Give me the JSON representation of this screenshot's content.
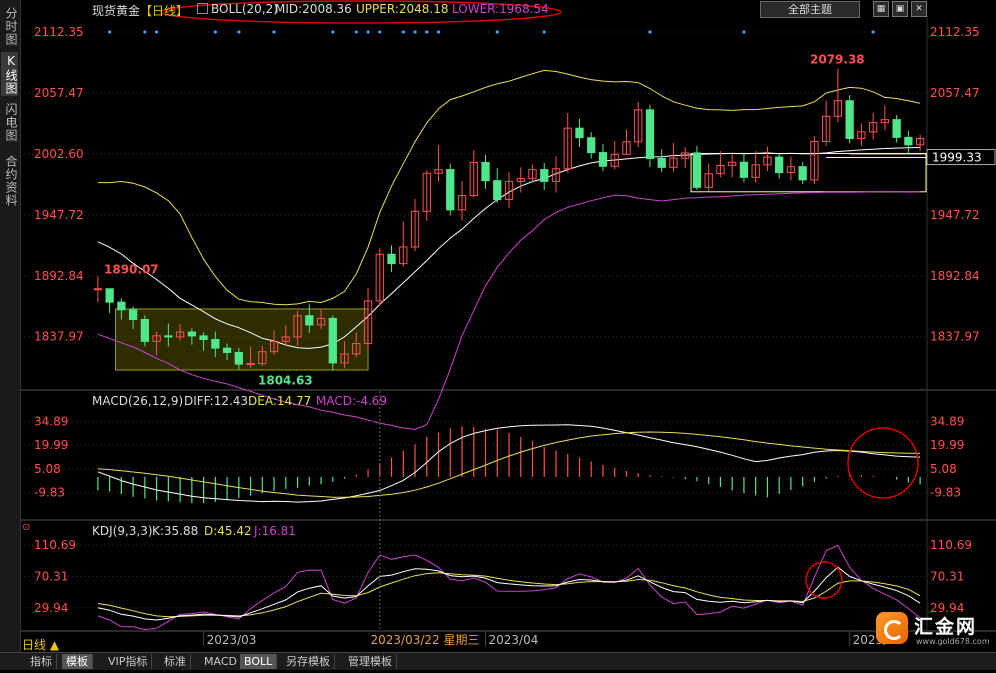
{
  "sidebar": {
    "tabs": [
      {
        "label": "分时图",
        "active": false
      },
      {
        "label": "K线图",
        "active": true
      },
      {
        "label": "闪电图",
        "active": false
      },
      {
        "label": "合约资料",
        "active": false
      }
    ]
  },
  "header": {
    "symbol": "现货黄金",
    "period_tag": "【日线】",
    "indicator": "BOLL(20,2)",
    "mid_label": "MID:2008.36",
    "upper_label": "UPPER:2048.18",
    "lower_label": "LOWER:1968.54",
    "theme_button": "全部主题",
    "window_buttons": [
      "▦",
      "▣",
      "✕"
    ]
  },
  "macd_header": {
    "title": "MACD(26,12,9)",
    "diff": "DIFF:12.43",
    "dea": "DEA:14.77",
    "macd": "MACD:-4.69"
  },
  "kdj_header": {
    "title": "KDJ(9,3,3)",
    "k": "K:35.88",
    "d": "D:45.42",
    "j": "J:16.81"
  },
  "crosshair_date": "2023/03/22 星期三",
  "period_selector": "日线 ▲",
  "bottom_tabs": [
    {
      "label": "指标",
      "active": false
    },
    {
      "label": "模板",
      "active": true
    },
    {
      "label": "VIP指标",
      "active": false
    },
    {
      "label": "标准",
      "active": false
    },
    {
      "label": "MACD",
      "active": false
    },
    {
      "label": "BOLL",
      "active": true
    },
    {
      "label": "另存模板",
      "active": false
    },
    {
      "label": "管理模板",
      "active": false
    }
  ],
  "logo": {
    "name": "汇金网",
    "url": "www.gold678.com"
  },
  "colors": {
    "up": "#ff5050",
    "down": "#50e68c",
    "mid": "#ffffa0",
    "boll": "#e8e050",
    "lower": "#d040d0",
    "axis_text": "#ff5050",
    "grid": "#2a2a2a",
    "annotation": "#e00000"
  },
  "chart_data": [
    {
      "type": "candlestick",
      "title": "现货黄金 日线 BOLL(20,2)",
      "y_ticks": [
        "2112.35",
        "2057.47",
        "2002.60",
        "1947.72",
        "1892.84",
        "1837.97"
      ],
      "ylim": [
        1790,
        2125
      ],
      "x_ticks": [
        "2023/03",
        "2023/04",
        "2023/05"
      ],
      "labels": {
        "high": "2079.38",
        "low": "1804.63",
        "start_high": "1890.07",
        "current": "1999.33"
      },
      "candles": [
        [
          1881.2,
          1881.2,
          1892.5,
          1869.1
        ],
        [
          1881.2,
          1869.1,
          1874.1,
          1859.1
        ],
        [
          1869.1,
          1862.2,
          1872.5,
          1853.5
        ],
        [
          1862.2,
          1853.5,
          1865.2,
          1845.1
        ],
        [
          1853.5,
          1833.8,
          1857.2,
          1829.4
        ],
        [
          1833.8,
          1838.8,
          1842.5,
          1821.4
        ],
        [
          1838.8,
          1837.8,
          1849.8,
          1829.1
        ],
        [
          1837.8,
          1842.2,
          1849.2,
          1834.4
        ],
        [
          1842.2,
          1838.7,
          1845.5,
          1830.8
        ],
        [
          1838.7,
          1835.5,
          1841.9,
          1825.4
        ],
        [
          1835.5,
          1827.7,
          1842.5,
          1819.6
        ],
        [
          1827.7,
          1823.8,
          1831.8,
          1816.9
        ],
        [
          1823.8,
          1813.3,
          1827.8,
          1808.5
        ],
        [
          1813.3,
          1813.8,
          1829.1,
          1809.5
        ],
        [
          1813.8,
          1824.5,
          1829.8,
          1811.6
        ],
        [
          1824.5,
          1833.8,
          1843.5,
          1821.6
        ],
        [
          1833.8,
          1837.8,
          1848.3,
          1829.8
        ],
        [
          1837.8,
          1856.9,
          1861.5,
          1829.8
        ],
        [
          1856.9,
          1848.6,
          1867.8,
          1841.5
        ],
        [
          1848.6,
          1854.5,
          1862.5,
          1845.1
        ],
        [
          1854.5,
          1814.4,
          1857.1,
          1807.5
        ],
        [
          1814.4,
          1822.4,
          1833.9,
          1809.5
        ],
        [
          1822.4,
          1831.8,
          1841.9,
          1819.5
        ],
        [
          1831.8,
          1870.2,
          1881.8,
          1825.4
        ],
        [
          1870.2,
          1912.2,
          1917.8,
          1866.2
        ],
        [
          1912.2,
          1903.8,
          1920.3,
          1896.2
        ],
        [
          1903.8,
          1918.8,
          1941.6,
          1901.2
        ],
        [
          1918.8,
          1950.9,
          1962.1,
          1915.1
        ],
        [
          1950.9,
          1985.2,
          1987.8,
          1942.5
        ],
        [
          1985.2,
          1988.5,
          2010.5,
          1977.8
        ],
        [
          1988.5,
          1952.2,
          1993.9,
          1947.1
        ],
        [
          1952.2,
          1965.1,
          1978.1,
          1942.5
        ],
        [
          1965.1,
          1994.9,
          2005.8,
          1963.5
        ],
        [
          1994.9,
          1978.5,
          2001.8,
          1971.2
        ],
        [
          1978.5,
          1961.5,
          1989.8,
          1958.5
        ],
        [
          1961.5,
          1977.8,
          1986.1,
          1953.8
        ],
        [
          1977.8,
          1980.3,
          1990.5,
          1967.8
        ],
        [
          1980.3,
          1988.5,
          1992.9,
          1977.1
        ],
        [
          1988.5,
          1977.8,
          1994.5,
          1970.2
        ],
        [
          1977.8,
          1989.2,
          2000.5,
          1967.8
        ],
        [
          1989.2,
          2025.8,
          2039.5,
          1985.8
        ],
        [
          2025.8,
          2017.2,
          2034.2,
          2008.8
        ],
        [
          2017.2,
          2003.8,
          2022.2,
          1998.5
        ],
        [
          2003.8,
          1991.5,
          2011.8,
          1987.1
        ],
        [
          1991.5,
          2002.2,
          2014.1,
          1988.5
        ],
        [
          2002.2,
          2013.5,
          2024.5,
          2001.8
        ],
        [
          2013.5,
          2042.3,
          2049.5,
          2008.8
        ],
        [
          2042.3,
          1998.5,
          2046.8,
          1990.8
        ],
        [
          1998.5,
          1990.5,
          2006.8,
          1986.1
        ],
        [
          1990.5,
          1998.8,
          2012.5,
          1986.8
        ],
        [
          1998.8,
          2003.5,
          2008.8,
          1989.8
        ],
        [
          2003.5,
          1972.5,
          2009.8,
          1970.2
        ],
        [
          1972.5,
          1984.8,
          1993.9,
          1969.1
        ],
        [
          1984.8,
          1992.2,
          2005.1,
          1981.5
        ],
        [
          1992.2,
          1995.1,
          2002.2,
          1981.5
        ],
        [
          1995.1,
          1981.5,
          2002.8,
          1977.1
        ],
        [
          1981.5,
          1992.8,
          2005.1,
          1976.8
        ],
        [
          1992.8,
          1999.8,
          2009.2,
          1987.1
        ],
        [
          1999.8,
          1985.8,
          2002.8,
          1980.5
        ],
        [
          1985.8,
          1991.1,
          2000.1,
          1978.8
        ],
        [
          1991.1,
          1979.2,
          1995.5,
          1975.5
        ],
        [
          1979.2,
          2013.8,
          2018.5,
          1975.5
        ],
        [
          2013.8,
          2036.5,
          2050.8,
          2009.8
        ],
        [
          2036.5,
          2050.5,
          2079.4,
          2030.8
        ],
        [
          2050.5,
          2016.5,
          2055.5,
          2012.2
        ],
        [
          2016.5,
          2022.5,
          2030.1,
          2009.8
        ],
        [
          2022.5,
          2030.8,
          2039.8,
          2015.5
        ],
        [
          2030.8,
          2033.5,
          2046.2,
          2023.8
        ],
        [
          2033.5,
          2017.5,
          2037.5,
          2012.8
        ],
        [
          2017.5,
          2010.8,
          2023.5,
          2002.8
        ],
        [
          2010.8,
          2016.5,
          2019.8,
          2005.5
        ]
      ],
      "boll_mid": [
        1923.5,
        1918.5,
        1912.5,
        1904.1,
        1896.8,
        1889.5,
        1881.5,
        1872.5,
        1866.6,
        1860.5,
        1854.1,
        1849.5,
        1846.1,
        1841.6,
        1836.6,
        1834.1,
        1830.5,
        1828.1,
        1827.5,
        1828.6,
        1831.6,
        1837.8,
        1846.9,
        1856.2,
        1867.1,
        1876.8,
        1886.5,
        1896.5,
        1906.5,
        1917.2,
        1926.8,
        1934.8,
        1944.5,
        1953.5,
        1961.5,
        1968.2,
        1973.5,
        1977.8,
        1980.5,
        1984.8,
        1988.5,
        1991.8,
        1994.5,
        1996.2,
        1997.1,
        1998.1,
        1999.1,
        1999.8,
        2000.1,
        2001.1,
        2001.5,
        2002.1,
        2002.5,
        2002.8,
        2003.1,
        2002.8,
        2003.1,
        2003.5,
        2002.8,
        2003.1,
        2002.8,
        2002.8,
        2003.5,
        2004.8,
        2005.5,
        2006.2,
        2006.8,
        2007.5,
        2007.8,
        2008.1,
        2008.36
      ],
      "boll_upper": [
        1976.8,
        1976.8,
        1977.8,
        1976.2,
        1972.8,
        1967.5,
        1960.5,
        1948.5,
        1927.5,
        1907.8,
        1892.2,
        1879.8,
        1871.8,
        1869.5,
        1868.8,
        1867.2,
        1866.8,
        1867.5,
        1869.8,
        1868.8,
        1872.5,
        1878.8,
        1894.5,
        1918.5,
        1949.8,
        1973.5,
        1993.8,
        2013.5,
        2030.5,
        2043.2,
        2051.5,
        2054.8,
        2058.5,
        2062.5,
        2065.8,
        2068.1,
        2071.5,
        2074.8,
        2077.8,
        2076.8,
        2074.5,
        2071.8,
        2069.5,
        2068.2,
        2067.5,
        2067.8,
        2066.8,
        2061.5,
        2054.8,
        2049.5,
        2046.5,
        2043.8,
        2042.5,
        2042.2,
        2041.8,
        2042.5,
        2042.5,
        2043.5,
        2044.5,
        2045.2,
        2045.8,
        2049.5,
        2057.5,
        2060.2,
        2062.5,
        2061.8,
        2058.5,
        2053.5,
        2052.5,
        2050.5,
        2048.18
      ],
      "boll_lower": [
        1840.2,
        1836.5,
        1832.5,
        1828.8,
        1823.8,
        1818.5,
        1813.8,
        1808.1,
        1803.8,
        1800.5,
        1797.8,
        1795.5,
        1792.2,
        1788.8,
        1785.1,
        1782.1,
        1778.8,
        1776.8,
        1774.8,
        1771.8,
        1769.8,
        1767.5,
        1765.8,
        1762.8,
        1760.2,
        1758.1,
        1755.8,
        1754.5,
        1758.8,
        1781.5,
        1808.8,
        1838.8,
        1861.5,
        1883.8,
        1900.5,
        1913.5,
        1924.8,
        1933.5,
        1943.5,
        1949.8,
        1954.5,
        1957.5,
        1960.5,
        1963.1,
        1965.5,
        1964.8,
        1962.8,
        1961.5,
        1960.2,
        1961.5,
        1962.8,
        1963.1,
        1963.8,
        1964.1,
        1964.8,
        1965.5,
        1965.8,
        1966.2,
        1966.8,
        1967.2,
        1967.5,
        1967.8,
        1968.1,
        1968.1,
        1968.1,
        1968.2,
        1968.5,
        1968.8,
        1968.5,
        1968.2,
        1968.54
      ],
      "level_lines": [
        1999.33,
        2002.6
      ]
    },
    {
      "type": "macd",
      "title": "MACD(26,12,9)",
      "y_ticks": [
        "34.89",
        "19.99",
        "5.08",
        "-9.83"
      ],
      "ylim": [
        -22,
        42
      ],
      "diff": [
        3.2,
        0.5,
        -2.3,
        -4.5,
        -6.3,
        -8.2,
        -9.5,
        -10.8,
        -12.1,
        -13.0,
        -13.6,
        -14.2,
        -14.8,
        -15.1,
        -15.5,
        -15.2,
        -15.4,
        -15.8,
        -15.5,
        -15.1,
        -14.1,
        -13.2,
        -11.8,
        -10.2,
        -8.5,
        -5.5,
        -2.1,
        2.8,
        9.1,
        15.8,
        21.0,
        24.8,
        27.3,
        29.1,
        30.5,
        31.4,
        32.1,
        32.4,
        32.5,
        32.6,
        32.7,
        32.3,
        31.8,
        30.7,
        29.2,
        27.8,
        26.3,
        24.6,
        23.1,
        21.5,
        20.3,
        18.9,
        17.3,
        15.6,
        13.6,
        11.4,
        9.6,
        10.4,
        11.9,
        13.1,
        14.0,
        15.5,
        16.3,
        16.6,
        16.2,
        15.6,
        14.6,
        13.8,
        13.1,
        12.7,
        12.43
      ],
      "dea": [
        5.1,
        4.6,
        3.9,
        3.1,
        2.3,
        1.4,
        0.4,
        -0.7,
        -1.9,
        -3.1,
        -4.3,
        -5.5,
        -6.7,
        -7.8,
        -8.9,
        -9.8,
        -10.6,
        -11.4,
        -11.9,
        -12.3,
        -12.7,
        -12.8,
        -12.6,
        -12.3,
        -11.6,
        -10.9,
        -9.8,
        -8.3,
        -6.3,
        -3.9,
        -1.1,
        1.8,
        4.6,
        7.4,
        10.4,
        13.1,
        15.6,
        17.8,
        19.8,
        21.6,
        23.1,
        24.5,
        25.6,
        26.5,
        27.2,
        27.7,
        28.1,
        28.2,
        28.1,
        27.8,
        27.3,
        26.7,
        26.0,
        25.2,
        24.3,
        23.3,
        22.2,
        21.2,
        20.4,
        19.5,
        18.8,
        18.1,
        17.4,
        16.9,
        16.4,
        16.0,
        15.6,
        15.3,
        15.0,
        14.9,
        14.77
      ],
      "hist": [
        -8.5,
        -9.2,
        -10.8,
        -12.5,
        -13.5,
        -14.8,
        -15.4,
        -15.9,
        -16.4,
        -16.3,
        -15.6,
        -14.5,
        -13.1,
        -11.8,
        -10.4,
        -8.9,
        -7.5,
        -6.8,
        -5.5,
        -4.6,
        -3.0,
        -1.0,
        1.5,
        4.8,
        8.6,
        12.2,
        16.5,
        20.5,
        25.2,
        27.8,
        30.5,
        31.8,
        31.4,
        30.2,
        29.5,
        27.6,
        25.1,
        22.5,
        18.8,
        16.5,
        14.5,
        12.2,
        9.7,
        7.5,
        5.6,
        3.8,
        2.4,
        1.2,
        0.5,
        -0.4,
        -1.4,
        -2.7,
        -4.5,
        -6.3,
        -8.5,
        -10.2,
        -11.6,
        -12.8,
        -10.6,
        -8.3,
        -5.9,
        -3.1,
        -1.0,
        0.6,
        1.2,
        1.1,
        0.8,
        0.2,
        -1.7,
        -3.5,
        -4.69
      ]
    },
    {
      "type": "kdj",
      "title": "KDJ(9,3,3)",
      "y_ticks": [
        "110.69",
        "70.31",
        "29.94"
      ],
      "ylim": [
        0,
        120
      ],
      "k": [
        30.1,
        26.8,
        21.5,
        19.2,
        15.6,
        14.2,
        16.5,
        19.8,
        20.5,
        21.8,
        20.8,
        19.5,
        18.1,
        23.5,
        28.8,
        34.5,
        40.1,
        50.5,
        55.2,
        58.5,
        45.2,
        42.5,
        44.5,
        58.2,
        70.5,
        72.1,
        76.5,
        80.2,
        79.8,
        77.5,
        71.5,
        70.1,
        70.8,
        68.2,
        62.5,
        60.8,
        59.5,
        58.5,
        58.1,
        58.5,
        63.2,
        66.5,
        65.8,
        63.5,
        63.2,
        65.5,
        71.2,
        63.5,
        56.1,
        50.8,
        49.5,
        40.8,
        38.5,
        37.1,
        38.5,
        36.5,
        37.8,
        39.5,
        38.1,
        38.8,
        36.5,
        51.5,
        68.8,
        82.5,
        70.5,
        64.8,
        60.5,
        56.5,
        52.1,
        45.5,
        35.88
      ],
      "d": [
        35.5,
        33.1,
        29.5,
        26.1,
        22.5,
        19.5,
        18.5,
        18.9,
        19.5,
        20.4,
        20.5,
        20.1,
        19.5,
        20.8,
        23.5,
        27.1,
        31.5,
        37.9,
        43.5,
        48.6,
        47.5,
        45.8,
        45.4,
        49.6,
        56.8,
        61.9,
        66.8,
        71.3,
        74.1,
        75.2,
        73.9,
        72.7,
        72.0,
        70.8,
        68.0,
        65.6,
        63.6,
        61.9,
        60.6,
        59.9,
        61.0,
        62.9,
        63.8,
        63.7,
        63.5,
        64.2,
        66.5,
        65.5,
        62.3,
        58.5,
        55.5,
        50.6,
        46.6,
        43.4,
        41.8,
        40.0,
        39.3,
        39.3,
        38.9,
        38.9,
        38.1,
        42.6,
        51.3,
        61.7,
        64.6,
        64.6,
        63.2,
        61.0,
        58.0,
        53.8,
        45.42
      ],
      "j": [
        19.3,
        14.2,
        5.5,
        5.4,
        1.8,
        3.6,
        12.5,
        21.6,
        22.5,
        24.6,
        21.4,
        18.3,
        15.3,
        28.9,
        39.4,
        49.3,
        57.3,
        75.7,
        78.6,
        78.3,
        40.6,
        35.9,
        42.7,
        75.4,
        97.9,
        92.5,
        95.9,
        98.0,
        91.2,
        82.1,
        66.7,
        64.9,
        68.4,
        63.0,
        51.5,
        51.2,
        51.3,
        51.7,
        53.1,
        55.7,
        67.6,
        73.7,
        69.8,
        63.1,
        62.6,
        68.1,
        80.6,
        59.5,
        43.7,
        35.4,
        37.5,
        21.2,
        22.3,
        24.5,
        31.9,
        29.5,
        34.8,
        39.9,
        36.5,
        38.6,
        33.3,
        69.3,
        103.8,
        110.5,
        82.3,
        65.2,
        55.1,
        47.5,
        40.3,
        28.9,
        16.81
      ]
    }
  ]
}
